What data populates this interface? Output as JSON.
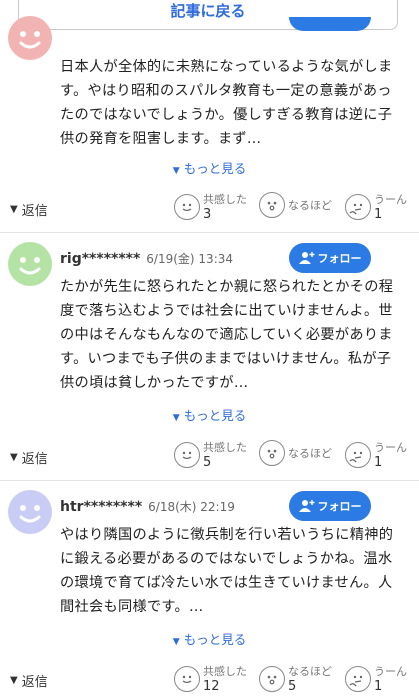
{
  "back_button": {
    "label": "記事に戻る"
  },
  "follow_label": "フォロー",
  "more_label": "もっと見る",
  "reply_label": "返信",
  "comments": [
    {
      "user": "",
      "date": "",
      "text": "日本人が全体的に未熟になっているような気がします。やはり昭和のスパルタ教育も一定の意義があったのではないでしょうか。優しすぎる教育は逆に子供の発育を阻害します。まず…",
      "avatar_color": "#f2b3b3",
      "reactions": [
        {
          "label": "共感した",
          "count": "3"
        },
        {
          "label": "なるほど",
          "count": ""
        },
        {
          "label": "うーん",
          "count": "1"
        }
      ]
    },
    {
      "user": "rig********",
      "date": "6/19(金) 13:34",
      "text": "たかが先生に怒られたとか親に怒られたとかその程度で落ち込むようでは社会に出ていけませんよ。世の中はそんなもんなので適応していく必要があります。いつまでも子供のままではいけません。私が子供の頃は貧しかったですが…",
      "avatar_color": "#b5e3a6",
      "reactions": [
        {
          "label": "共感した",
          "count": "5"
        },
        {
          "label": "なるほど",
          "count": ""
        },
        {
          "label": "うーん",
          "count": "1"
        }
      ]
    },
    {
      "user": "htr********",
      "date": "6/18(木) 22:19",
      "text": "やはり隣国のように徴兵制を行い若いうちに精神的に鍛える必要があるのではないでしょうかね。温水の環境で育てば冷たい水では生きていけません。人間社会も同様です。…",
      "avatar_color": "#c9cdf5",
      "reactions": [
        {
          "label": "共感した",
          "count": "12"
        },
        {
          "label": "なるほど",
          "count": "5"
        },
        {
          "label": "うーん",
          "count": "1"
        }
      ]
    }
  ],
  "colors": {
    "accent": "#2c7be5",
    "link": "#2f6bdc"
  }
}
